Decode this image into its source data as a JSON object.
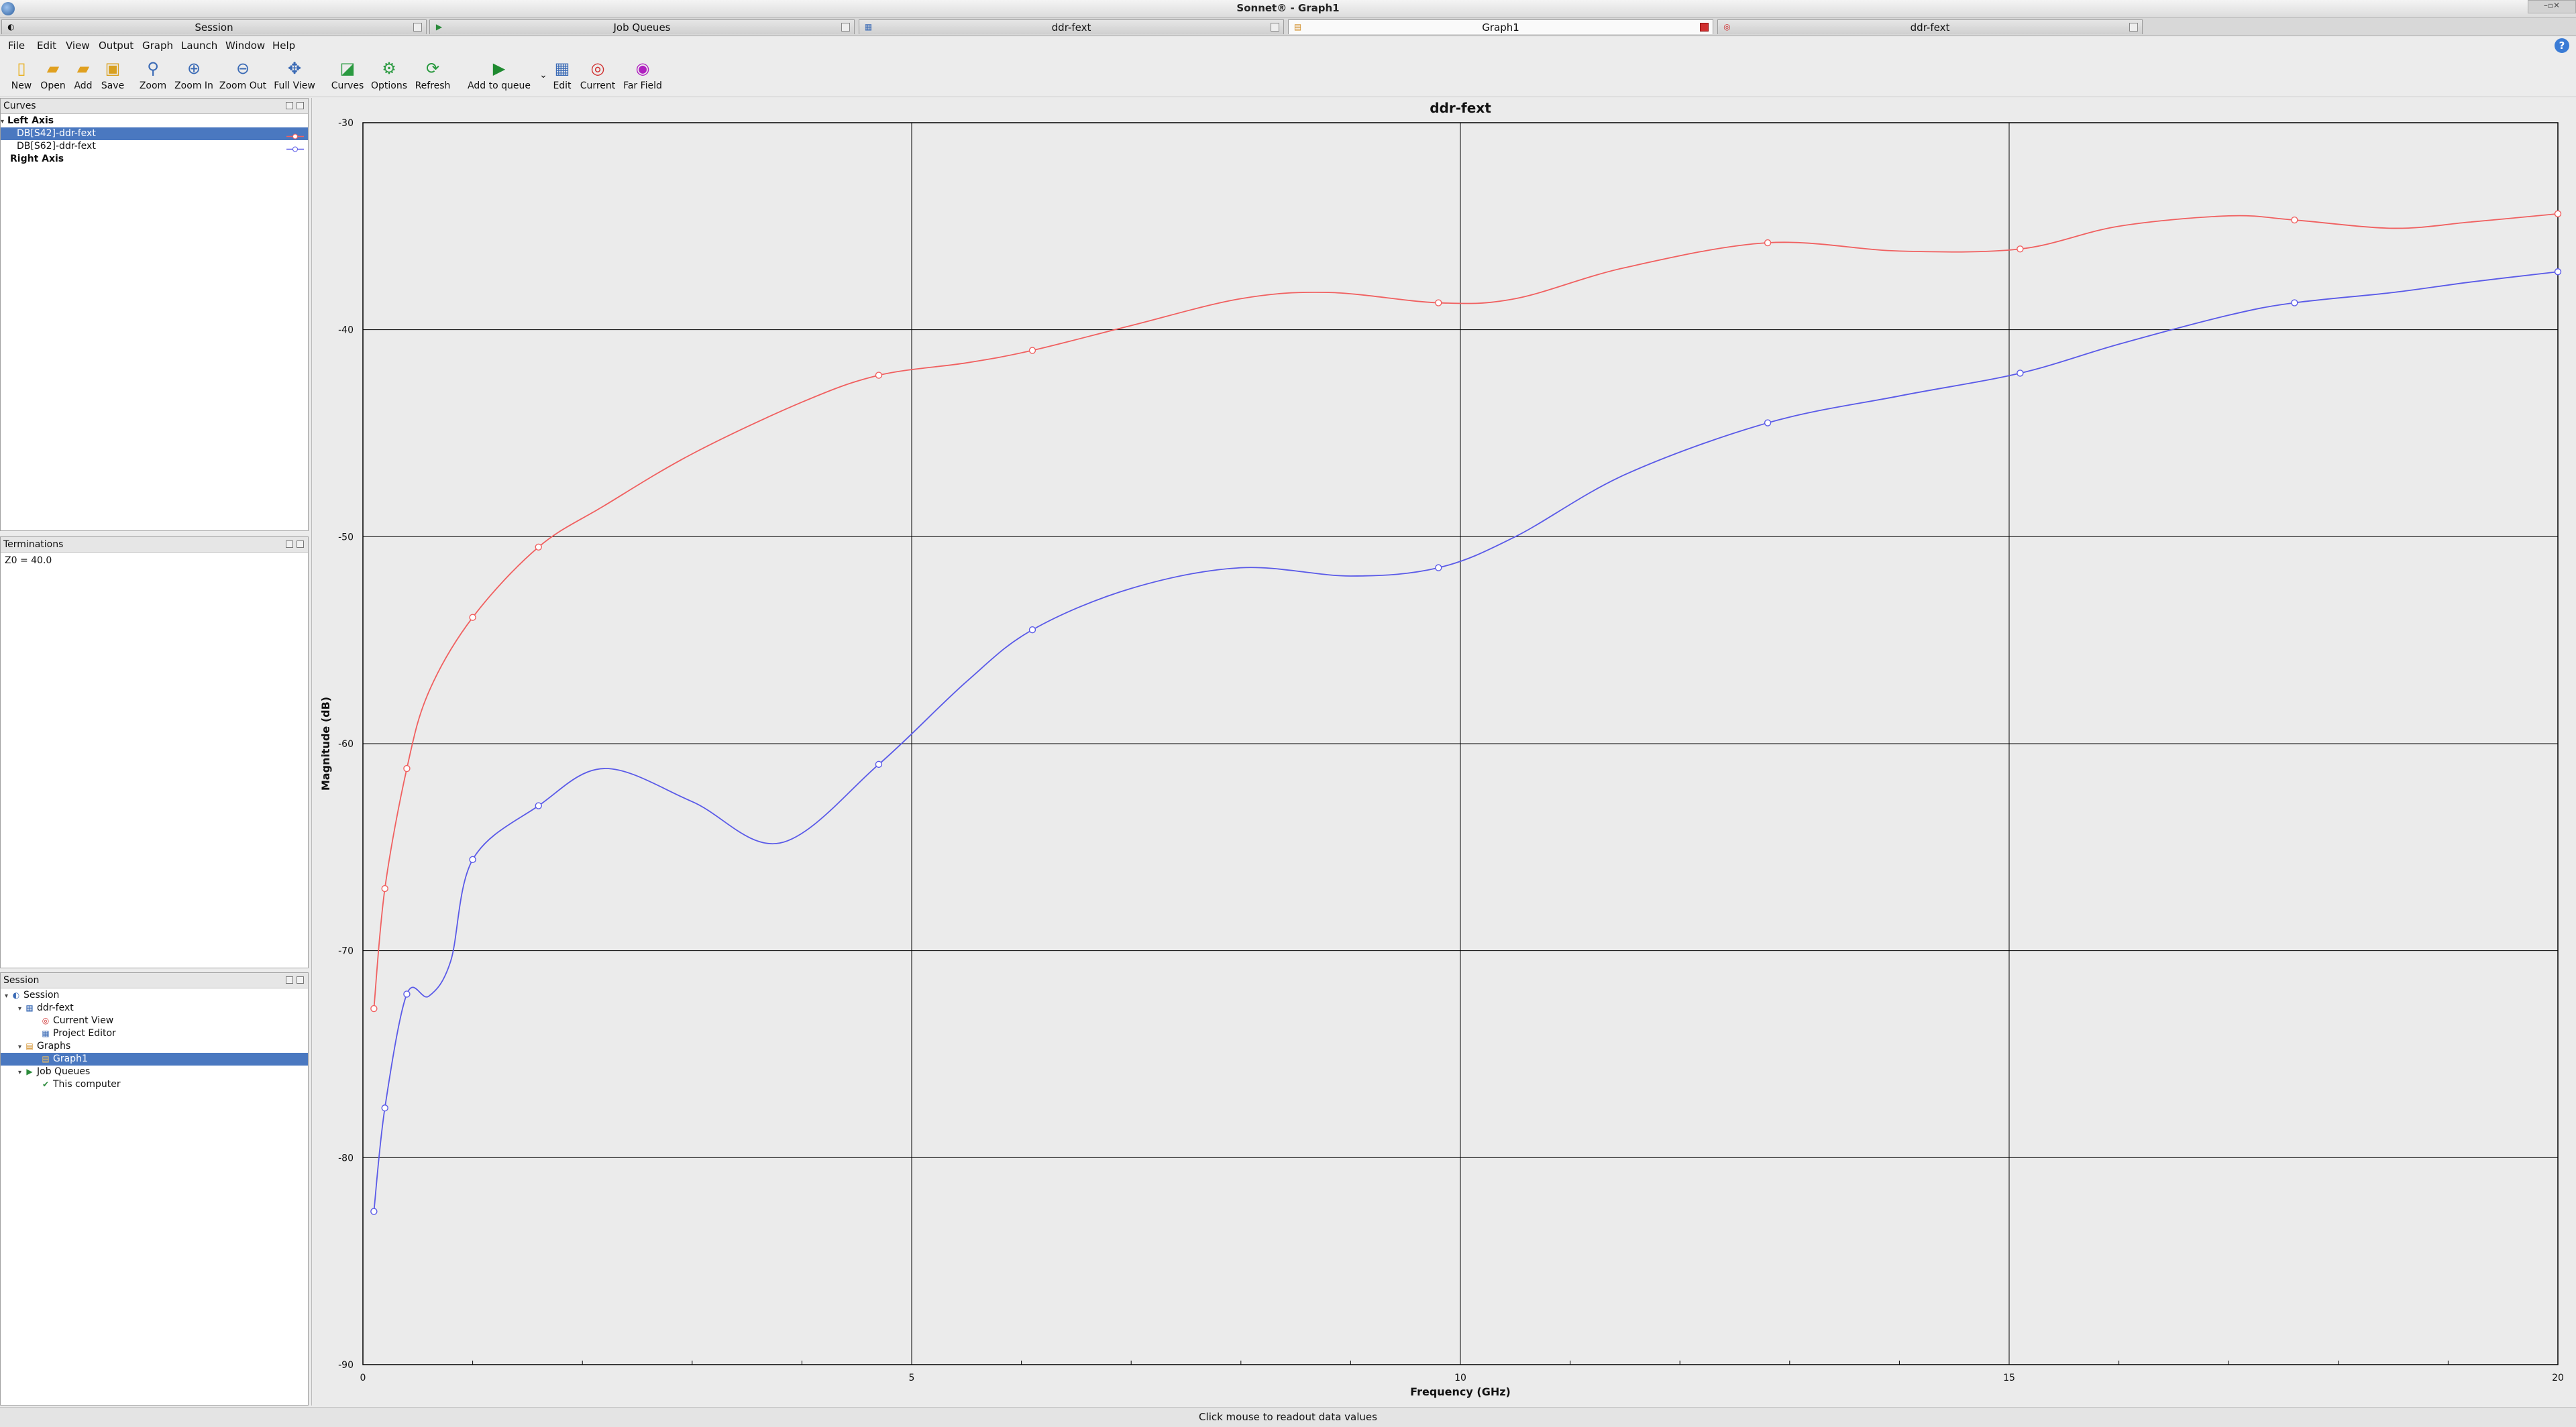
{
  "window": {
    "title": "Sonnet® - Graph1"
  },
  "tabs": [
    {
      "label": "Session",
      "icon": "session-icon",
      "active": false
    },
    {
      "label": "Job Queues",
      "icon": "queue-icon",
      "active": false
    },
    {
      "label": "ddr-fext",
      "icon": "project-icon",
      "active": false
    },
    {
      "label": "Graph1",
      "icon": "graph-icon",
      "active": true
    },
    {
      "label": "ddr-fext",
      "icon": "current-view-icon",
      "active": false
    }
  ],
  "menu": [
    "File",
    "Edit",
    "View",
    "Output",
    "Graph",
    "Launch",
    "Window",
    "Help"
  ],
  "toolbar": {
    "new": "New",
    "open": "Open",
    "add": "Add",
    "save": "Save",
    "zoom": "Zoom",
    "zoom_in": "Zoom In",
    "zoom_out": "Zoom Out",
    "full_view": "Full View",
    "curves": "Curves",
    "options": "Options",
    "refresh": "Refresh",
    "add_to_queue": "Add to queue",
    "edit": "Edit",
    "current": "Current",
    "far_field": "Far Field"
  },
  "curves_panel": {
    "title": "Curves",
    "left_axis": "Left Axis",
    "items": [
      "DB[S42]-ddr-fext",
      "DB[S62]-ddr-fext"
    ],
    "right_axis": "Right Axis"
  },
  "terminations_panel": {
    "title": "Terminations",
    "text": "Z0 = 40.0"
  },
  "session_panel": {
    "title": "Session",
    "tree": {
      "session": "Session",
      "project": "ddr-fext",
      "current_view": "Current View",
      "project_editor": "Project Editor",
      "graphs": "Graphs",
      "graph1": "Graph1",
      "job_queues": "Job Queues",
      "this_computer": "This computer"
    }
  },
  "status": {
    "text": "Click mouse to readout data values"
  },
  "colors": {
    "series1": "#f06060",
    "series2": "#5a5ae8",
    "selection": "#4a78c0"
  },
  "chart_data": {
    "type": "line",
    "title": "ddr-fext",
    "xlabel": "Frequency (GHz)",
    "ylabel": "Magnitude (dB)",
    "xlim": [
      0,
      20
    ],
    "ylim": [
      -90,
      -30
    ],
    "xticks": [
      0,
      5,
      10,
      15,
      20
    ],
    "yticks": [
      -30,
      -40,
      -50,
      -60,
      -70,
      -80,
      -90
    ],
    "grid": true,
    "series": [
      {
        "name": "DB[S42]-ddr-fext",
        "x": [
          0.1,
          0.2,
          0.4,
          0.6,
          1.0,
          1.6,
          2.2,
          3.0,
          4.0,
          4.7,
          5.5,
          6.1,
          7.0,
          8.0,
          8.8,
          9.8,
          10.5,
          11.5,
          12.8,
          14.0,
          15.1,
          16.0,
          17.0,
          17.6,
          18.5,
          19.2,
          20.0
        ],
        "y": [
          -72.8,
          -67.0,
          -61.2,
          -57.5,
          -53.9,
          -50.5,
          -48.5,
          -46.0,
          -43.5,
          -42.2,
          -41.6,
          -41.0,
          -39.8,
          -38.5,
          -38.2,
          -38.7,
          -38.5,
          -37.0,
          -35.8,
          -36.2,
          -36.1,
          -35.0,
          -34.5,
          -34.7,
          -35.1,
          -34.8,
          -34.4
        ]
      },
      {
        "name": "DB[S62]-ddr-fext",
        "x": [
          0.1,
          0.2,
          0.4,
          0.6,
          0.8,
          1.0,
          1.6,
          2.2,
          3.0,
          3.8,
          4.7,
          5.5,
          6.1,
          7.0,
          8.0,
          9.0,
          9.8,
          10.5,
          11.5,
          12.8,
          14.0,
          15.1,
          16.0,
          17.0,
          17.6,
          18.5,
          19.2,
          20.0
        ],
        "y": [
          -82.6,
          -77.6,
          -72.1,
          -72.2,
          -70.5,
          -65.6,
          -63.0,
          -61.2,
          -62.8,
          -64.8,
          -61.0,
          -57.0,
          -54.5,
          -52.5,
          -51.5,
          -51.9,
          -51.5,
          -50.0,
          -47.0,
          -44.5,
          -43.2,
          -42.1,
          -40.7,
          -39.3,
          -38.7,
          -38.2,
          -37.7,
          -37.2
        ]
      }
    ]
  }
}
